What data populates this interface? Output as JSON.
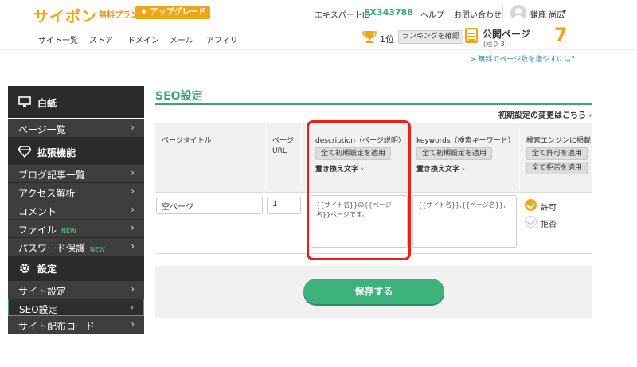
{
  "header": {
    "logo": "サイポン",
    "plan": "無料プラン",
    "upgrade_label": "アップグレード",
    "expert_label": "エキスパートID",
    "expert_id": "EX343788",
    "help": "ヘルプ",
    "contact": "お問い合わせ",
    "username": "鎌鹿 尚広"
  },
  "nav": {
    "items": [
      "サイト一覧",
      "ストア",
      "ドメイン",
      "メール",
      "アフィリ"
    ],
    "rank": "1位",
    "rank_button": "ランキングを確認",
    "pages_title": "公開ページ",
    "pages_remaining": "(残り 3)",
    "pages_count": "7",
    "more_link": "> 無料でページ数を増やすには？"
  },
  "sidebar": {
    "section1": "白紙",
    "item_pages": "ページ一覧",
    "section2": "拡張機能",
    "item_blog": "ブログ記事一覧",
    "item_access": "アクセス解析",
    "item_comment": "コメント",
    "item_file": "ファイル",
    "item_password": "パスワード保護",
    "new_badge": "NEW",
    "section3": "設定",
    "item_site_settings": "サイト設定",
    "item_seo": "SEO設定",
    "item_embed": "サイト配布コード"
  },
  "main": {
    "title": "SEO設定",
    "reset_link": "初期設定の変更はこちら",
    "columns": {
      "page_title": "ページタイトル",
      "page_url": "ページ\nURL",
      "description": "description（ページ説明）",
      "keywords": "keywords（検索キーワード）",
      "search_engine": "検索エンジンに掲載"
    },
    "btn_apply_all": "全て初期設定を適用",
    "btn_allow_all": "全て許可を適用",
    "btn_deny_all": "全て拒否を適用",
    "replace_text": "置き換え文字",
    "row": {
      "title": "空ページ",
      "url": "1",
      "description": "{{サイト名}}の{{ページ名}}ページです。",
      "keywords": "{{サイト名}},{{ページ名}},",
      "allow": "許可",
      "deny": "拒否"
    },
    "save": "保存する"
  }
}
